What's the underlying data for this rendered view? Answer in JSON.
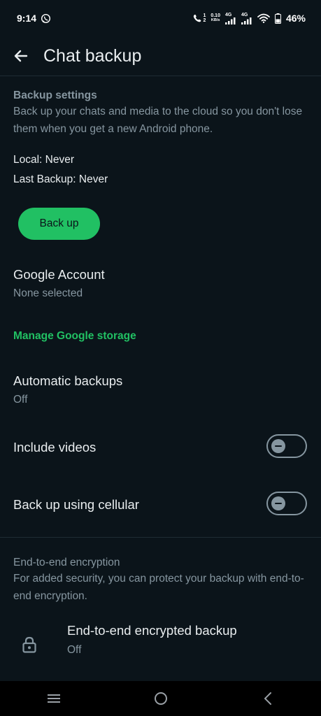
{
  "status_bar": {
    "time": "9:14",
    "call_sim_top": "1",
    "call_sim_bottom": "2",
    "net_speed_value": "0.10",
    "net_speed_unit": "KB/s",
    "sim1_tech": "4G",
    "sim2_tech": "4G",
    "battery": "46%",
    "battery_level": 0.46
  },
  "app_bar": {
    "title": "Chat backup"
  },
  "backup_settings": {
    "header": "Backup settings",
    "description": "Back up your chats and media to the cloud so you don't lose them when you get a new Android phone.",
    "local": "Local: Never",
    "last_backup": "Last Backup: Never",
    "button": "Back up"
  },
  "google_account": {
    "title": "Google Account",
    "value": "None selected"
  },
  "manage_storage": "Manage Google storage",
  "automatic_backups": {
    "title": "Automatic backups",
    "value": "Off"
  },
  "include_videos": {
    "title": "Include videos",
    "enabled": false
  },
  "cellular": {
    "title": "Back up using cellular",
    "enabled": false
  },
  "encryption": {
    "header": "End-to-end encryption",
    "description": "For added security, you can protect your backup with end-to-end encryption.",
    "item_title": "End-to-end encrypted backup",
    "item_value": "Off"
  },
  "colors": {
    "accent": "#21c063",
    "background": "#0b141a",
    "secondary_text": "#8696a0"
  }
}
